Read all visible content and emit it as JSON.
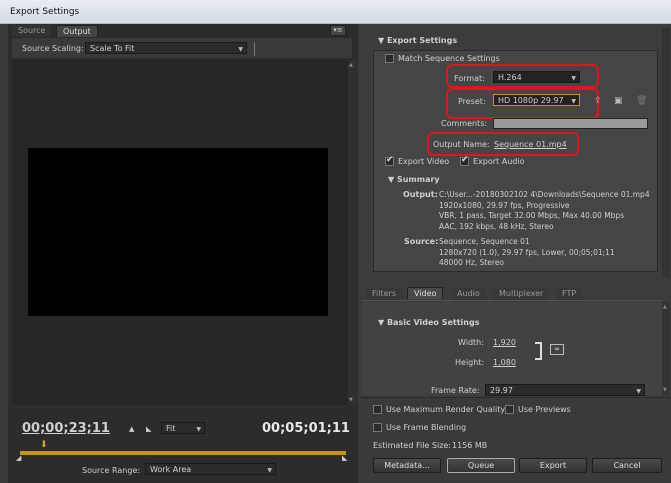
{
  "window": {
    "title": "Export Settings"
  },
  "left": {
    "tabs": [
      "Source",
      "Output"
    ],
    "source_scaling_label": "Source Scaling:",
    "source_scaling_value": "Scale To Fit",
    "timecode_current": "00;00;23;11",
    "timecode_duration": "00;05;01;11",
    "fit_value": "Fit",
    "source_range_label": "Source Range:",
    "source_range_value": "Work Area"
  },
  "export_settings": {
    "header": "Export Settings",
    "match_sequence": "Match Sequence Settings",
    "format_label": "Format:",
    "format_value": "H.264",
    "preset_label": "Preset:",
    "preset_value": "HD 1080p 29.97",
    "comments_label": "Comments:",
    "output_name_label": "Output Name:",
    "output_name_value": "Sequence 01.mp4",
    "export_video": "Export Video",
    "export_audio": "Export Audio"
  },
  "summary": {
    "header": "Summary",
    "output_label": "Output:",
    "output_lines": [
      "C:\\User...-20180302102 4\\Downloads\\Sequence 01.mp4",
      "1920x1080, 29.97 fps, Progressive",
      "VBR, 1 pass, Target 32.00 Mbps, Max 40.00 Mbps",
      "AAC, 192 kbps, 48 kHz, Stereo"
    ],
    "source_label": "Source:",
    "source_lines": [
      "Sequence, Sequence 01",
      "1280x720 (1.0), 29.97 fps, Lower, 00;05;01;11",
      "48000 Hz, Stereo"
    ]
  },
  "tabs2": [
    "Filters",
    "Video",
    "Audio",
    "Multiplexer",
    "FTP"
  ],
  "video": {
    "header": "Basic Video Settings",
    "width_label": "Width:",
    "width_value": "1,920",
    "height_label": "Height:",
    "height_value": "1,080",
    "frame_rate_label": "Frame Rate:",
    "frame_rate_value": "29.97"
  },
  "bottom": {
    "max_render": "Use Maximum Render Quality",
    "use_previews": "Use Previews",
    "frame_blending": "Use Frame Blending",
    "file_size_label": "Estimated File Size:",
    "file_size_value": "1156 MB",
    "metadata": "Metadata...",
    "queue": "Queue",
    "export": "Export",
    "cancel": "Cancel"
  }
}
